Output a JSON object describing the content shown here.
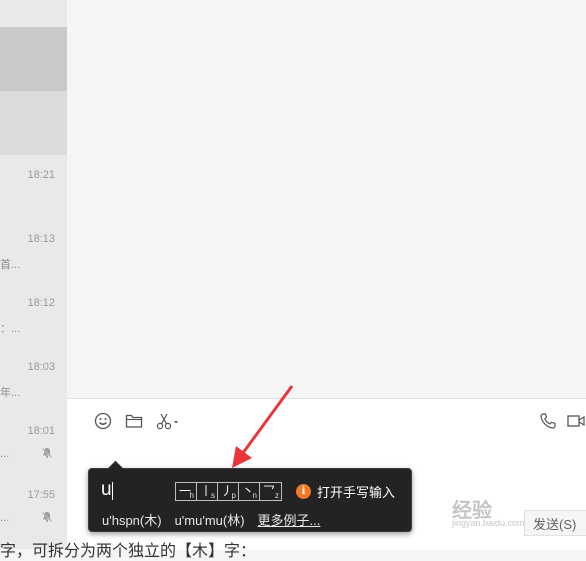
{
  "conversations": [
    {
      "time": "18:21",
      "snippet": "",
      "muted": false
    },
    {
      "time": "18:13",
      "snippet": "首...",
      "muted": false
    },
    {
      "time": "18:12",
      "snippet": "：...",
      "muted": false
    },
    {
      "time": "18:03",
      "snippet": "年...",
      "muted": false
    },
    {
      "time": "18:01",
      "snippet": "...",
      "muted": true
    },
    {
      "time": "17:55",
      "snippet": "...",
      "muted": true
    }
  ],
  "toolbar": {
    "emoji_icon": "smiley-icon",
    "folder_icon": "folder-icon",
    "scissors_icon": "scissors-icon",
    "call_icon": "phone-icon",
    "video_icon": "video-icon"
  },
  "ime": {
    "composition": "u",
    "strokes": [
      {
        "glyph": "一",
        "key": "h"
      },
      {
        "glyph": "丨",
        "key": "s"
      },
      {
        "glyph": "丿",
        "key": "p"
      },
      {
        "glyph": "丶",
        "key": "n"
      },
      {
        "glyph": "乛",
        "key": "z"
      }
    ],
    "handwriting_label": "打开手写输入",
    "candidates": [
      "u'hspn(木)",
      "u'mu'mu(林)"
    ],
    "more_label": "更多例子..."
  },
  "send_label": "发送(S)",
  "bottom_text": "字，可拆分为两个独立的【木】字：",
  "watermark": {
    "main": "经验",
    "sub": "jingyan.baidu.com"
  },
  "colors": {
    "sidebar": "#e9e9e9",
    "selected": "#c9c9c9",
    "ime_bg": "#232323",
    "arrow": "#e8363a",
    "info": "#f07a28"
  }
}
